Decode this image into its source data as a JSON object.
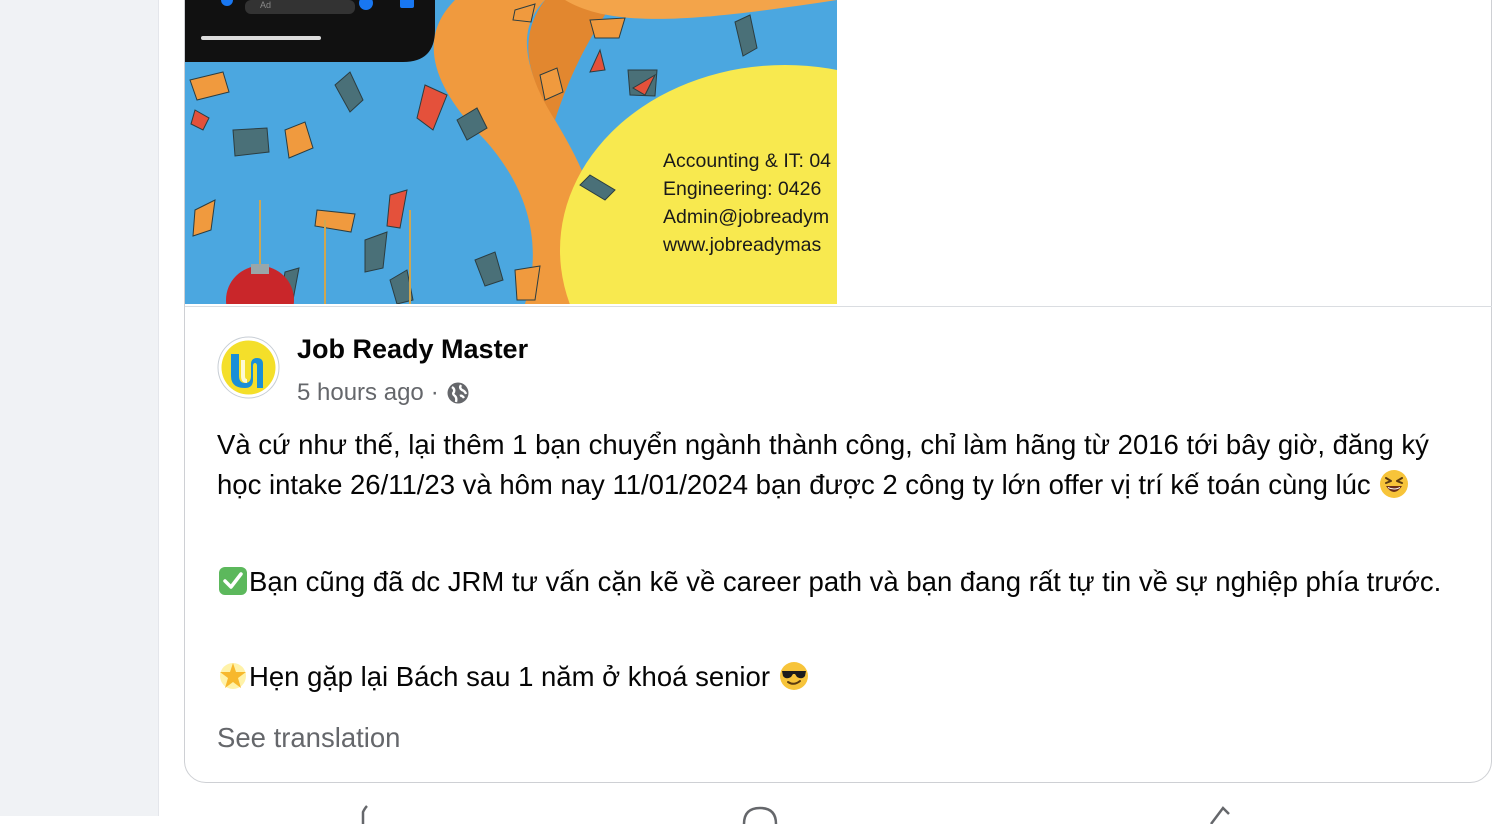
{
  "post": {
    "author": "Job Ready Master",
    "time": "5 hours ago",
    "separator": "·",
    "audience_icon": "globe-icon",
    "paragraphs": {
      "p1": "Và cứ như thế, lại thêm 1 bạn chuyển ngành thành công, chỉ làm hãng từ 2016 tới bây giờ, đăng ký học intake 26/11/23 và hôm nay 11/01/2024 bạn được 2 công ty lớn offer vị trí kế toán cùng lúc",
      "p2": "Bạn cũng đã dc JRM tư vấn cặn kẽ về career path và bạn đang rất tự tin về sự nghiệp phía trước.",
      "p3": "Hẹn gặp lại Bách sau 1 năm ở khoá senior"
    },
    "see_translation": "See translation"
  },
  "image": {
    "contact": {
      "line1": "Accounting & IT: 04",
      "line2": "Engineering: 0426",
      "line3": "Admin@jobreadym",
      "line4": "www.jobreadymas"
    },
    "ad_label": "Ad"
  },
  "colors": {
    "sky_blue": "#4ba7e0",
    "yellow": "#f8e94f",
    "orange": "#f09a3e",
    "text_secondary": "#65676b"
  }
}
